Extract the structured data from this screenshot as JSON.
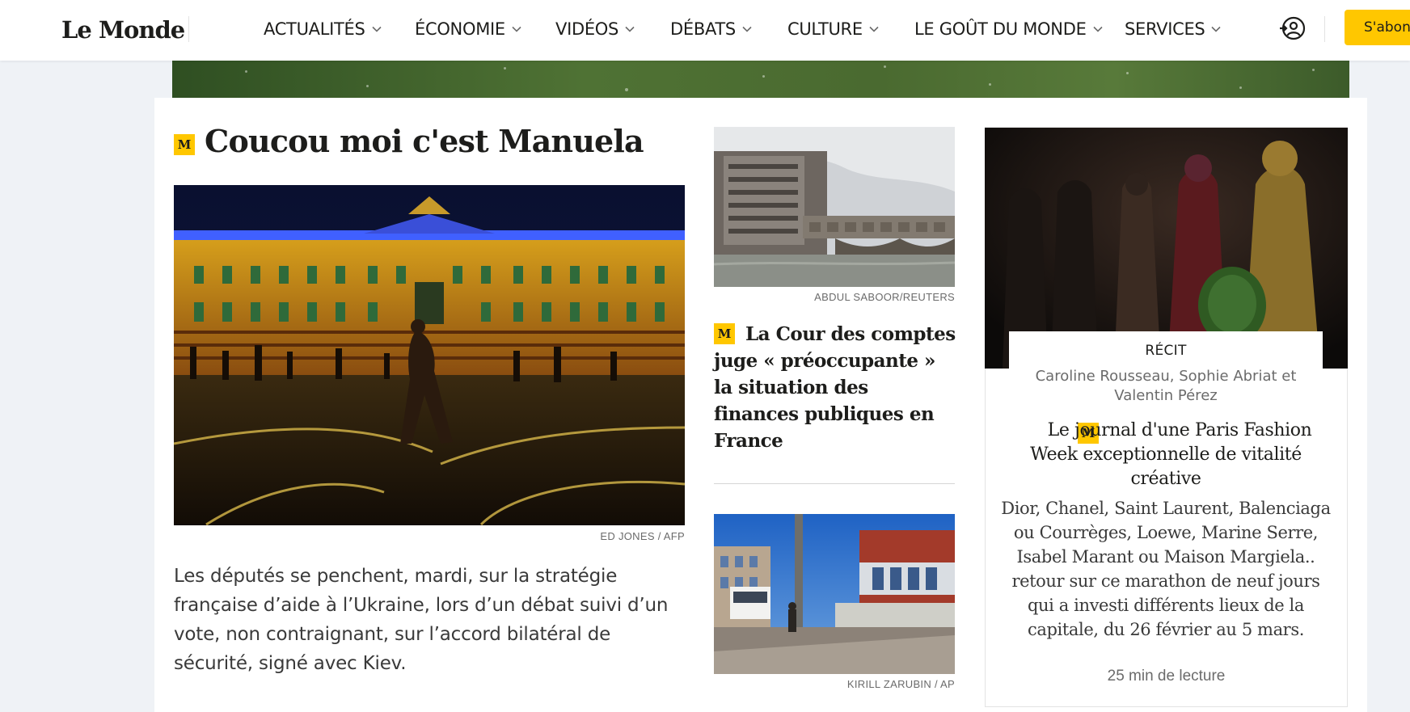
{
  "header": {
    "logo": "Le Monde",
    "nav": [
      {
        "label": "ACTUALITÉS"
      },
      {
        "label": "ÉCONOMIE"
      },
      {
        "label": "VIDÉOS"
      },
      {
        "label": "DÉBATS"
      },
      {
        "label": "CULTURE"
      },
      {
        "label": "LE GOÛT DU MONDE"
      },
      {
        "label": "SERVICES"
      }
    ],
    "account_icon": "account-icon",
    "subscribe_label": "S'abonner"
  },
  "lead": {
    "badge": "M",
    "title": "Coucou moi c'est Manuela",
    "photo_credit": "ED JONES / AFP",
    "summary": "Les députés se penchent, mardi, sur la stratégie française d’aide à l’Ukraine, lors d’un débat suivi d’un vote, non contraignant, sur l’accord bilatéral de sécurité, signé avec Kiev."
  },
  "middle": {
    "photo1_credit": "ABDUL SABOOR/REUTERS",
    "badge": "M",
    "headline": "La Cour des comptes juge « préoccupante » la situation des finances publiques en France",
    "photo2_credit": "KIRILL ZARUBIN / AP"
  },
  "feature": {
    "kicker": "RÉCIT",
    "authors": "Caroline Rousseau, Sophie Abriat et Valentin Pérez",
    "badge": "M",
    "title": "Le journal d'une Paris Fashion Week exceptionnelle de vitalité créative",
    "description": "Dior, Chanel, Saint Laurent, Balenciaga ou Courrèges, Loewe, Marine Serre, Isabel Marant ou Maison Margiela.. retour sur ce marathon de neuf jours qui a investi différents lieux de la capitale, du 26 février au 5 mars.",
    "read_time": "25 min de lecture"
  },
  "colors": {
    "accent": "#ffc700",
    "text": "#1d1d1b",
    "muted": "#6b6b6b",
    "page_bg": "#eff2f6"
  }
}
